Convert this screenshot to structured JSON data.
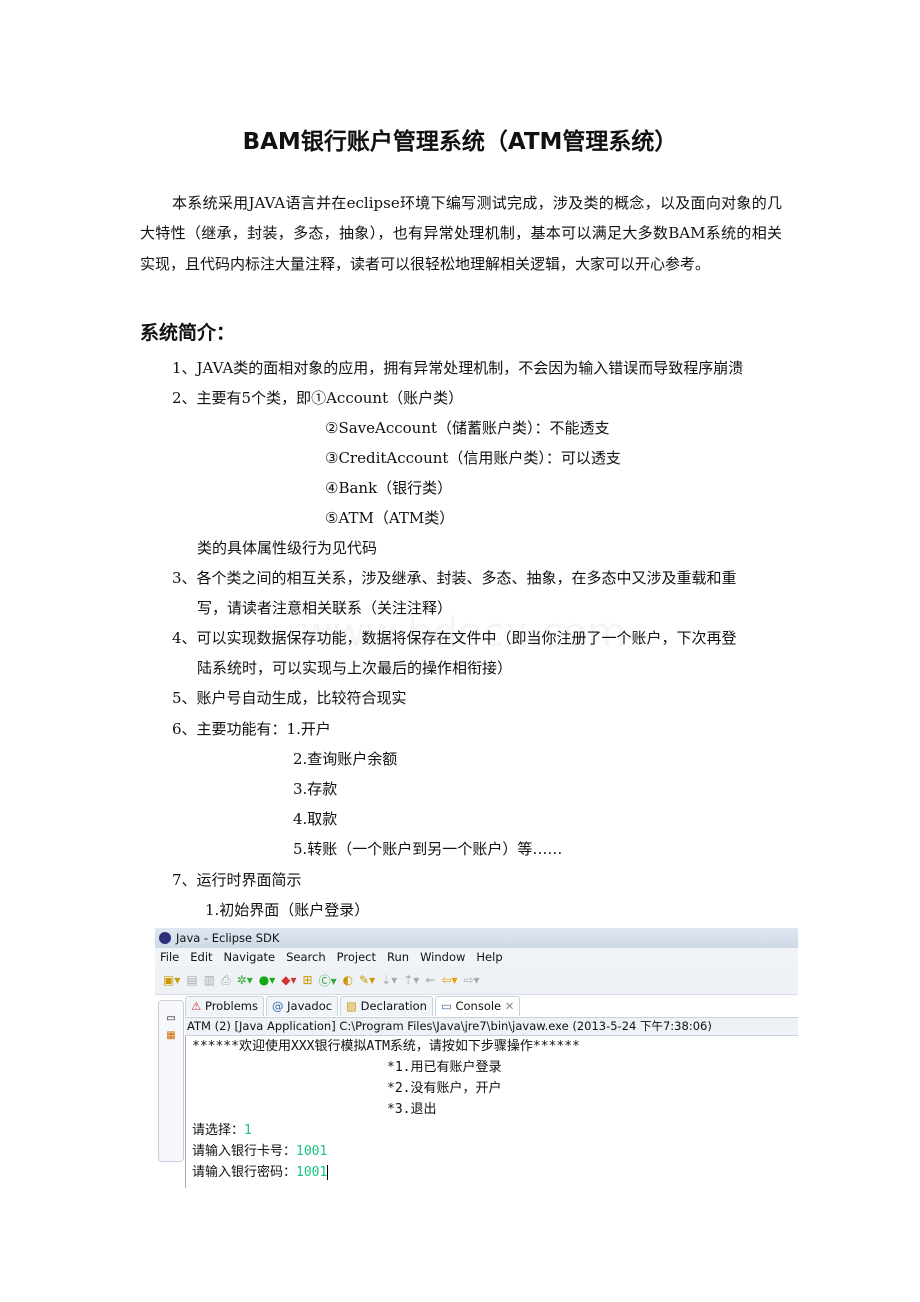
{
  "title": "BAM银行账户管理系统（ATM管理系统）",
  "intro": "本系统采用JAVA语言并在eclipse环境下编写测试完成，涉及类的概念，以及面向对象的几大特性（继承，封装，多态，抽象），也有异常处理机制，基本可以满足大多数BAM系统的相关实现，且代码内标注大量注释，读者可以很轻松地理解相关逻辑，大家可以开心参考。",
  "section_heading": "系统简介：",
  "items": {
    "i1": "1、JAVA类的面相对象的应用，拥有异常处理机制，不会因为输入错误而导致程序崩溃",
    "i2": "2、主要有5个类，即①Account（账户类）",
    "i2_sub": [
      "②SaveAccount（储蓄账户类）：不能透支",
      "③CreditAccount（信用账户类）：可以透支",
      "④Bank（银行类）",
      "⑤ATM（ATM类）"
    ],
    "i2_note": "类的具体属性级行为见代码",
    "i3a": "3、各个类之间的相互关系，涉及继承、封装、多态、抽象，在多态中又涉及重载和重",
    "i3b": "写，请读者注意相关联系（关注注释）",
    "i4a": "4、可以实现数据保存功能，数据将保存在文件中（即当你注册了一个账户，下次再登",
    "i4b": "陆系统时，可以实现与上次最后的操作相衔接）",
    "i5": "5、账户号自动生成，比较符合现实",
    "i6": "6、主要功能有：1.开户",
    "i6_sub": [
      "2.查询账户余额",
      "3.存款",
      "4.取款",
      "5.转账（一个账户到另一个账户）等……"
    ],
    "i7": "7、运行时界面简示",
    "i7_sub": "1.初始界面（账户登录）"
  },
  "watermark": "www.bdocx.com",
  "screenshot": {
    "window_title": "Java - Eclipse SDK",
    "menu": [
      "File",
      "Edit",
      "Navigate",
      "Search",
      "Project",
      "Run",
      "Window",
      "Help"
    ],
    "tabs": [
      "Problems",
      "Javadoc",
      "Declaration",
      "Console"
    ],
    "console_header": "ATM (2) [Java Application] C:\\Program Files\\Java\\jre7\\bin\\javaw.exe (2013-5-24 下午7:38:06)",
    "lines": {
      "welcome": "******欢迎使用XXX银行模拟ATM系统，请按如下步骤操作******",
      "opt1": "*1.用已有账户登录",
      "opt2": "*2.没有账户，开户",
      "opt3": "*3.退出",
      "choose_prompt": "请选择：",
      "choose_value": "1",
      "card_prompt": "请输入银行卡号：",
      "card_value": "1001",
      "pwd_prompt": "请输入银行密码：",
      "pwd_value": "1001"
    },
    "input_color": "#19c37d"
  }
}
